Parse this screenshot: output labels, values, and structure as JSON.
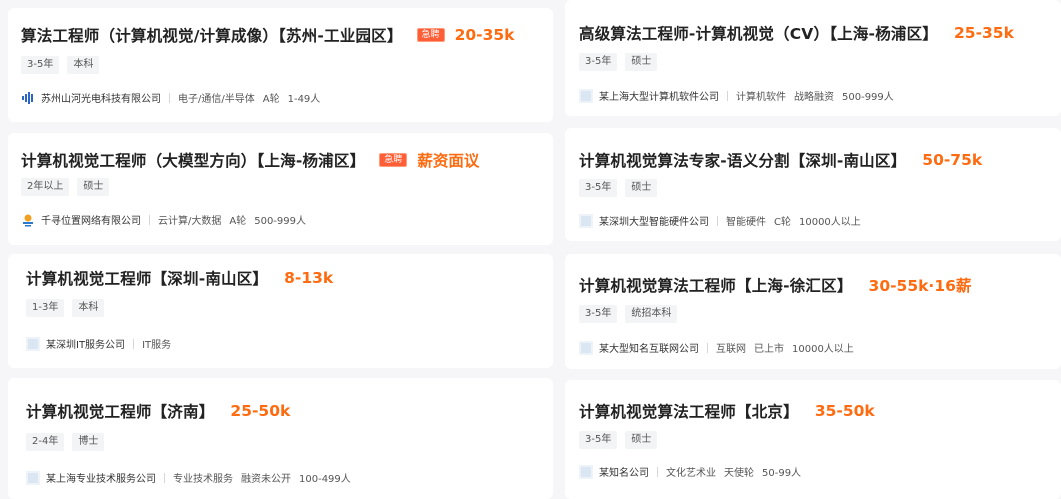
{
  "jobs": [
    {
      "title": "算法工程师（计算机视觉/计算成像）【苏州-工业园区】",
      "urgent": "急聘",
      "salary": "20-35k",
      "tags": [
        "3-5年",
        "本科"
      ],
      "company": "苏州山河光电科技有限公司",
      "meta": [
        "电子/通信/半导体",
        "A轮",
        "1-49人"
      ],
      "logo": "shanhe-logo"
    },
    {
      "title": "计算机视觉工程师（大模型方向）【上海-杨浦区】",
      "urgent": "急聘",
      "salary": "薪资面议",
      "tags": [
        "2年以上",
        "硕士"
      ],
      "company": "千寻位置网络有限公司",
      "meta": [
        "云计算/大数据",
        "A轮",
        "500-999人"
      ],
      "logo": "qianxun-logo"
    },
    {
      "title": "计算机视觉工程师【深圳-南山区】",
      "urgent": "",
      "salary": "8-13k",
      "tags": [
        "1-3年",
        "本科"
      ],
      "company": "某深圳IT服务公司",
      "meta": [
        "IT服务"
      ],
      "logo": "placeholder-logo"
    },
    {
      "title": "计算机视觉工程师【济南】",
      "urgent": "",
      "salary": "25-50k",
      "tags": [
        "2-4年",
        "博士"
      ],
      "company": "某上海专业技术服务公司",
      "meta": [
        "专业技术服务",
        "融资未公开",
        "100-499人"
      ],
      "logo": "placeholder-logo"
    },
    {
      "title": "高级算法工程师-计算机视觉（CV）【上海-杨浦区】",
      "urgent": "",
      "salary": "25-35k",
      "tags": [
        "3-5年",
        "硕士"
      ],
      "company": "某上海大型计算机软件公司",
      "meta": [
        "计算机软件",
        "战略融资",
        "500-999人"
      ],
      "logo": "placeholder-logo"
    },
    {
      "title": "计算机视觉算法专家-语义分割【深圳-南山区】",
      "urgent": "",
      "salary": "50-75k",
      "tags": [
        "3-5年",
        "硕士"
      ],
      "company": "某深圳大型智能硬件公司",
      "meta": [
        "智能硬件",
        "C轮",
        "10000人以上"
      ],
      "logo": "placeholder-logo"
    },
    {
      "title": "计算机视觉算法工程师【上海-徐汇区】",
      "urgent": "",
      "salary": "30-55k·16薪",
      "tags": [
        "3-5年",
        "统招本科"
      ],
      "company": "某大型知名互联网公司",
      "meta": [
        "互联网",
        "已上市",
        "10000人以上"
      ],
      "logo": "placeholder-logo"
    },
    {
      "title": "计算机视觉算法工程师【北京】",
      "urgent": "",
      "salary": "35-50k",
      "tags": [
        "3-5年",
        "硕士"
      ],
      "company": "某知名公司",
      "meta": [
        "文化艺术业",
        "天使轮",
        "50-99人"
      ],
      "logo": "placeholder-logo"
    }
  ]
}
